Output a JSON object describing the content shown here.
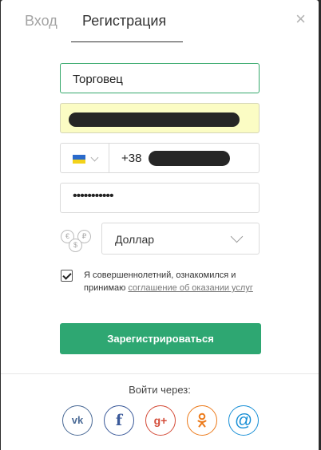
{
  "tabs": {
    "login": "Вход",
    "register": "Регистрация"
  },
  "close_glyph": "×",
  "form": {
    "name_value": "Торговец",
    "phone_code": "+38",
    "password_value": "•••••••••••",
    "currency_value": "Доллар",
    "coin_symbols": [
      "€",
      "₽",
      "$"
    ],
    "agree_text": "Я совершеннолетний, ознакомился и принимаю",
    "agree_link": "соглашение об оказании услуг",
    "submit_label": "Зарегистрироваться"
  },
  "footer": {
    "login_via": "Войти через:",
    "socials": [
      {
        "name": "vk",
        "glyph": "vk",
        "color": "#4a6a96"
      },
      {
        "name": "facebook",
        "glyph": "f",
        "color": "#3b5a9a"
      },
      {
        "name": "google-plus",
        "glyph": "g+",
        "color": "#d44c39"
      },
      {
        "name": "odnoklassniki",
        "glyph": "",
        "color": "#ec7a1a"
      },
      {
        "name": "mail",
        "glyph": "@",
        "color": "#188fd6"
      }
    ]
  },
  "colors": {
    "accent_green": "#2ea772",
    "autofill_yellow": "#fbfcc4",
    "flag_blue": "#2a6acb",
    "flag_yellow": "#f3d21a"
  }
}
